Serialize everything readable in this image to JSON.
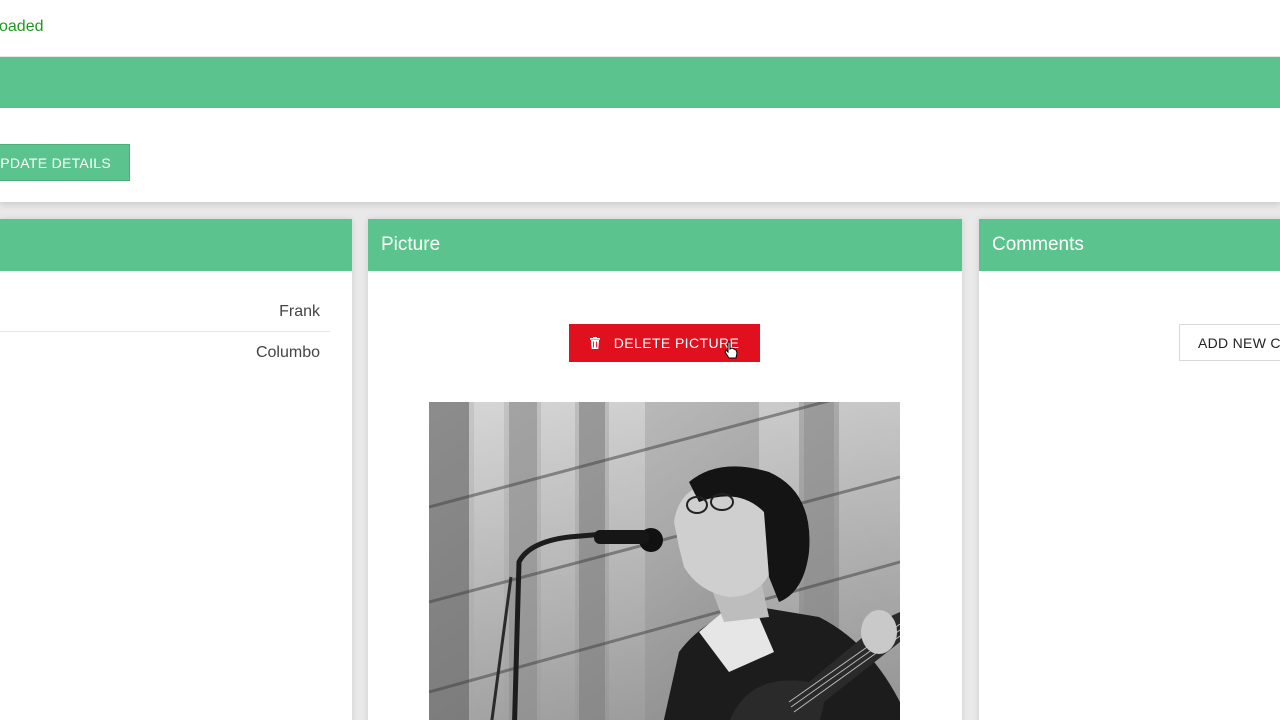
{
  "status": {
    "message": "oaded",
    "color": "#1f9a1f"
  },
  "toolbar": {
    "update_label": "PDATE DETAILS"
  },
  "details_card": {
    "rows": [
      {
        "value": "Frank"
      },
      {
        "value": "Columbo"
      }
    ]
  },
  "picture_card": {
    "title": "Picture",
    "delete_label": "DELETE PICTURE",
    "delete_icon": "trash-icon",
    "photo_alt": "black-and-white photo of a singer with glasses at a microphone playing guitar"
  },
  "comments_card": {
    "title": "Comments",
    "add_label": "ADD NEW C"
  },
  "colors": {
    "accent": "#5bc48e",
    "danger": "#e0101e",
    "background": "#e9e9e9"
  }
}
